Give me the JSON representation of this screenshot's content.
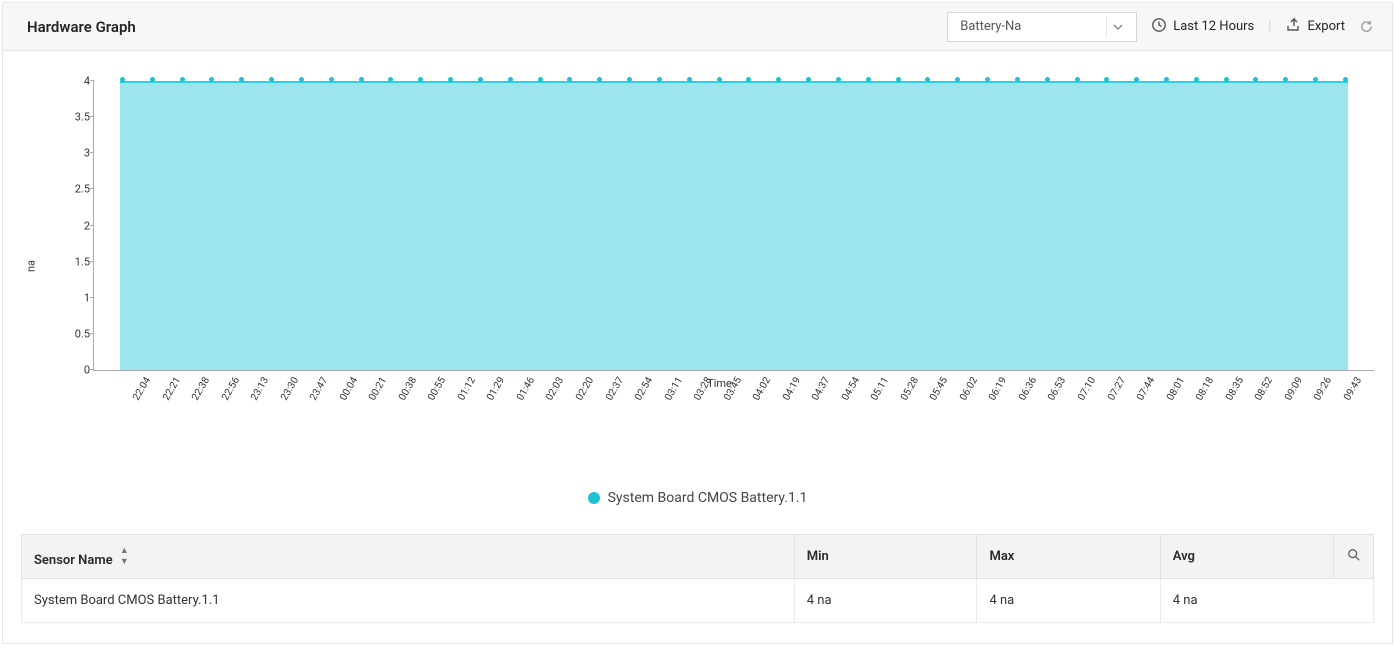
{
  "header": {
    "title": "Hardware Graph",
    "dropdown_value": "Battery-Na",
    "time_range": "Last 12 Hours",
    "export_label": "Export"
  },
  "chart_data": {
    "type": "area",
    "ylabel": "na",
    "xlabel": "Time",
    "ylim": [
      0,
      4
    ],
    "y_ticks": [
      0,
      0.5,
      1,
      1.5,
      2,
      2.5,
      3,
      3.5,
      4
    ],
    "categories": [
      "22:04",
      "22:21",
      "22:38",
      "22:56",
      "23:13",
      "23:30",
      "23:47",
      "00:04",
      "00:21",
      "00:38",
      "00:55",
      "01:12",
      "01:29",
      "01:46",
      "02:03",
      "02:20",
      "02:37",
      "02:54",
      "03:11",
      "03:28",
      "03:45",
      "04:02",
      "04:19",
      "04:37",
      "04:54",
      "05:11",
      "05:28",
      "05:45",
      "06:02",
      "06:19",
      "06:36",
      "06:53",
      "07:10",
      "07:27",
      "07:44",
      "08:01",
      "08:18",
      "08:35",
      "08:52",
      "09:09",
      "09:26",
      "09:43"
    ],
    "series": [
      {
        "name": "System Board CMOS Battery.1.1",
        "color": "#1fc0d4",
        "values": [
          4,
          4,
          4,
          4,
          4,
          4,
          4,
          4,
          4,
          4,
          4,
          4,
          4,
          4,
          4,
          4,
          4,
          4,
          4,
          4,
          4,
          4,
          4,
          4,
          4,
          4,
          4,
          4,
          4,
          4,
          4,
          4,
          4,
          4,
          4,
          4,
          4,
          4,
          4,
          4,
          4,
          4
        ]
      }
    ]
  },
  "table": {
    "columns": {
      "c0": "Sensor Name",
      "c1": "Min",
      "c2": "Max",
      "c3": "Avg"
    },
    "rows": [
      {
        "name": "System Board CMOS Battery.1.1",
        "min": "4 na",
        "max": "4 na",
        "avg": "4 na"
      }
    ]
  }
}
